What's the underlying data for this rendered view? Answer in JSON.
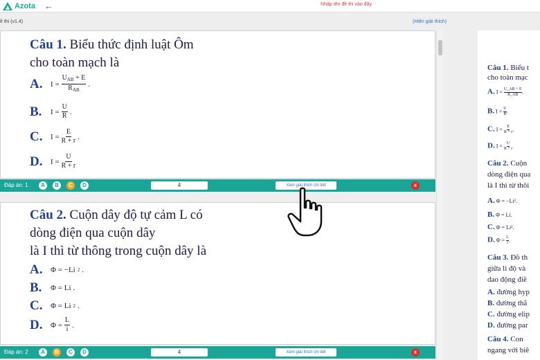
{
  "app": {
    "logo_text": "Azota",
    "back_icon": "arrow-left-icon",
    "title_placeholder": "Nhập tên đề thi vào đây"
  },
  "subbar": {
    "version": "ề thi (v1.4)",
    "toggle_explain": "(Hiện giải thích)"
  },
  "questions": [
    {
      "num": "Câu 1.",
      "title_line1": "Biểu thức định luật Ôm",
      "title_line2": "cho toàn mạch là",
      "options": {
        "A": {
          "letter": "A.",
          "lhs": "I =",
          "num": "U",
          "num_sub": "AB",
          "num_tail": "+ E",
          "den": "R",
          "den_sub": "AB",
          "tail": "."
        },
        "B": {
          "letter": "B.",
          "lhs": "I =",
          "num": "U",
          "den": "R",
          "tail": "."
        },
        "C": {
          "letter": "C.",
          "lhs": "I =",
          "num": "E",
          "den": "R + r",
          "tail": "."
        },
        "D": {
          "letter": "D.",
          "lhs": "I =",
          "num": "U",
          "den": "R + r",
          "tail": ""
        }
      },
      "answer_label": "Đáp án: 1",
      "choices": [
        "A",
        "B",
        "C",
        "D"
      ],
      "selected": "C",
      "count": "4",
      "explain_btn": "Xem giải thích chi tiết",
      "close": "x"
    },
    {
      "num": "Câu 2.",
      "title_line1": "Cuộn dây độ tự cảm L có",
      "title_line2": "dòng điện qua cuộn dây",
      "title_line3": "là I thì từ thông trong cuộn dây là",
      "options": {
        "A": {
          "letter": "A.",
          "text": "Φ = −Li",
          "sup": "2",
          "tail": "."
        },
        "B": {
          "letter": "B.",
          "text": "Φ = Li",
          "tail": "."
        },
        "C": {
          "letter": "C.",
          "text": "Φ = Li",
          "sup": "2",
          "tail": "."
        },
        "D": {
          "letter": "D.",
          "lhs": "Φ =",
          "num": "L",
          "den": "i",
          "tail": "."
        }
      },
      "answer_label": "Đáp án: 2",
      "choices": [
        "A",
        "B",
        "C",
        "D"
      ],
      "selected": "B",
      "count": "4",
      "explain_btn": "Xem giải thích chi tiết",
      "close": "x"
    }
  ],
  "preview": {
    "q1_num": "Câu 1.",
    "q1_l1": "Biểu t",
    "q1_l2": "cho toàn mạc",
    "q1_a": "A.",
    "q1_a_lhs": "I =",
    "q1_a_num": "U_AB + E",
    "q1_a_den": "R_AB",
    "q1_a_tail": ".",
    "q1_b": "B.",
    "q1_b_lhs": "I =",
    "q1_b_num": "U",
    "q1_b_den": "R",
    "q1_b_tail": ".",
    "q1_c": "C.",
    "q1_c_lhs": "I =",
    "q1_c_num": "E",
    "q1_c_den": "R + r",
    "q1_c_tail": ".",
    "q1_d": "D.",
    "q1_d_lhs": "I =",
    "q1_d_num": "U",
    "q1_d_den": "R + r",
    "q2_num": "Câu 2.",
    "q2_l1": "Cuộn",
    "q2_l2": "dòng điện qua",
    "q2_l3": "là I thì từ thôi",
    "q2_a": "A.",
    "q2_a_t": "Φ = −Li².",
    "q2_b": "B.",
    "q2_b_t": "Φ = Li.",
    "q2_c": "C.",
    "q2_c_t": "Φ = Li².",
    "q2_d": "D.",
    "q2_d_lhs": "Φ =",
    "q2_d_num": "L",
    "q2_d_den": "i",
    "q2_d_tail": ".",
    "q3_num": "Câu 3.",
    "q3_l1": "Đồ th",
    "q3_l2": "giữa li độ và",
    "q3_l3": "dao động điề",
    "q3_a": "A.",
    "q3_a_t": "đường hyp",
    "q3_b": "B.",
    "q3_b_t": "đường thẳ",
    "q3_c": "C.",
    "q3_c_t": "đường elip",
    "q3_d": "D.",
    "q3_d_t": "đường par",
    "q4_num": "Câu 4.",
    "q4_l1": "Con",
    "q4_l2": "ngang với biê"
  },
  "colors": {
    "accent": "#1aa597",
    "selected": "#f5a623",
    "close": "#e02a2a",
    "link": "#2f6fd6",
    "heading": "#1f3f9a"
  }
}
